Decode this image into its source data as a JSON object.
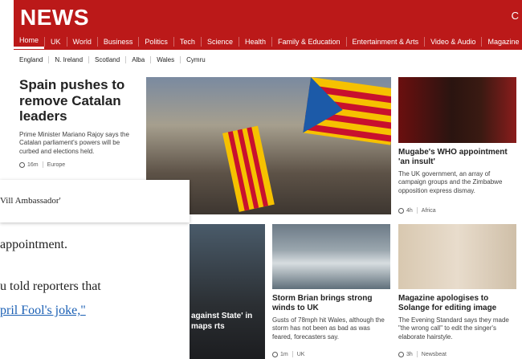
{
  "header": {
    "logo": "NEWS",
    "right_fragment": "C",
    "nav": [
      "Home",
      "UK",
      "World",
      "Business",
      "Politics",
      "Tech",
      "Science",
      "Health",
      "Family & Education",
      "Entertainment & Arts",
      "Video & Audio",
      "Magazine"
    ]
  },
  "subnav": [
    "England",
    "N. Ireland",
    "Scotland",
    "Alba",
    "Wales",
    "Cymru"
  ],
  "lead": {
    "title": "Spain pushes to remove Catalan leaders",
    "summary": "Prime Minister Mariano Rajoy says the Catalan parliament's powers will be curbed and elections held.",
    "time": "16m",
    "section": "Europe"
  },
  "stories": {
    "mugabe": {
      "title": "Mugabe's WHO appointment 'an insult'",
      "summary": "The UK government, an array of campaign groups and the Zimbabwe opposition express dismay.",
      "time": "4h",
      "section": "Africa"
    },
    "storm": {
      "title": "Storm Brian brings strong winds to UK",
      "summary": "Gusts of 78mph hit Wales, although the storm has not been as bad as was feared, forecasters say.",
      "time": "1m",
      "section": "UK"
    },
    "solange": {
      "title": "Magazine apologises to Solange for editing image",
      "summary": "The Evening Standard says they made \"the wrong call\" to edit the singer's elaborate hairstyle.",
      "time": "3h",
      "section": "Newsbeat"
    },
    "isis": {
      "caption": "against State' in maps rts"
    }
  },
  "overlay": {
    "card_text": "Vill Ambassador'",
    "line1": " appointment.",
    "line2": "u told reporters that",
    "link": "pril Fool's joke,\""
  }
}
